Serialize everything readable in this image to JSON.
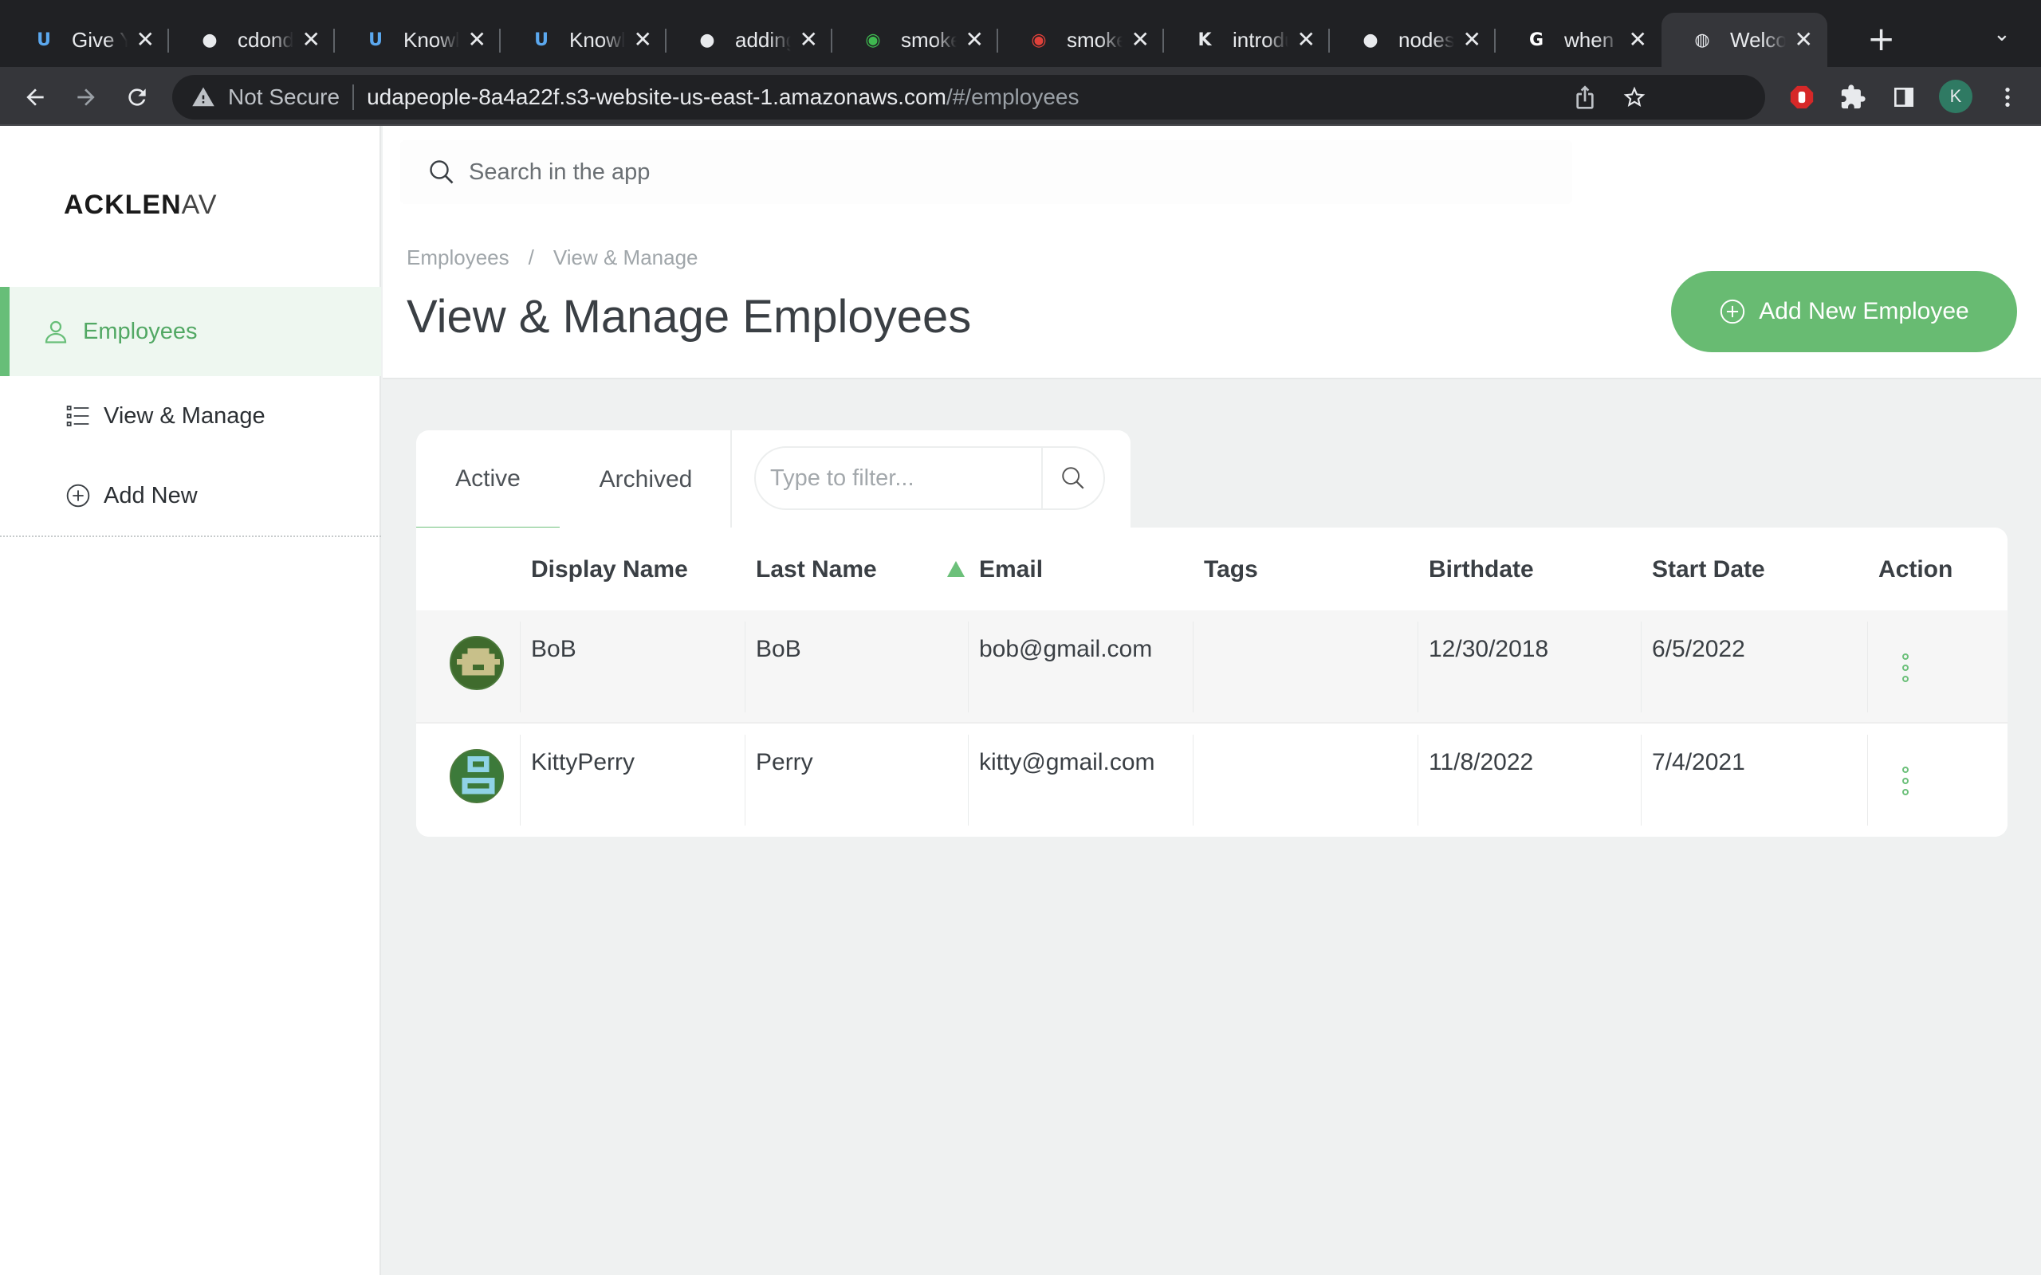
{
  "browser": {
    "tabs": [
      {
        "title": "Give Yo",
        "icon": "udacity-icon",
        "color": "#5ba8ef"
      },
      {
        "title": "cdond-",
        "icon": "github-icon",
        "color": "#e8eaed"
      },
      {
        "title": "Knowle",
        "icon": "udacity-icon",
        "color": "#5ba8ef"
      },
      {
        "title": "Knowle",
        "icon": "udacity-icon",
        "color": "#5ba8ef"
      },
      {
        "title": "adding",
        "icon": "github-icon",
        "color": "#e8eaed"
      },
      {
        "title": "smoke-",
        "icon": "circleci-green-icon",
        "color": "#3fb950"
      },
      {
        "title": "smoke-",
        "icon": "circleci-red-icon",
        "color": "#e0413a"
      },
      {
        "title": "introdu",
        "icon": "k-icon",
        "color": "#e8eaed"
      },
      {
        "title": "nodesc",
        "icon": "github-icon",
        "color": "#e8eaed"
      },
      {
        "title": "when t",
        "icon": "google-icon",
        "color": "#ffffff"
      },
      {
        "title": "Welcon",
        "icon": "globe-icon",
        "color": "#e8eaed",
        "active": true
      }
    ],
    "security_label": "Not Secure",
    "url_host": "udapeople-8a4a22f.s3-website-us-east-1.amazonaws.com",
    "url_path": "/#/employees",
    "profile_initial": "K"
  },
  "sidebar": {
    "logo_bold": "ACKLEN",
    "logo_light": "AV",
    "main_item": "Employees",
    "items": [
      {
        "label": "View & Manage",
        "icon": "list-icon"
      },
      {
        "label": "Add New",
        "icon": "plus-circle-icon"
      }
    ]
  },
  "header": {
    "search_placeholder": "Search in the app",
    "breadcrumb": [
      "Employees",
      "View & Manage"
    ],
    "title": "View & Manage Employees",
    "add_button": "Add New Employee"
  },
  "tabs": {
    "active": "Active",
    "archived": "Archived",
    "filter_placeholder": "Type to filter..."
  },
  "table": {
    "columns": [
      "Display Name",
      "Last Name",
      "Email",
      "Tags",
      "Birthdate",
      "Start Date",
      "Action"
    ],
    "sorted_column": "Email",
    "sort_direction": "ascending",
    "rows": [
      {
        "display_name": "BoB",
        "last_name": "BoB",
        "email": "bob@gmail.com",
        "tags": "",
        "birthdate": "12/30/2018",
        "start_date": "6/5/2022"
      },
      {
        "display_name": "KittyPerry",
        "last_name": "Perry",
        "email": "kitty@gmail.com",
        "tags": "",
        "birthdate": "11/8/2022",
        "start_date": "7/4/2021"
      }
    ]
  },
  "colors": {
    "accent": "#68bb72",
    "chrome_dark": "#202124",
    "chrome_toolbar": "#35363a"
  }
}
